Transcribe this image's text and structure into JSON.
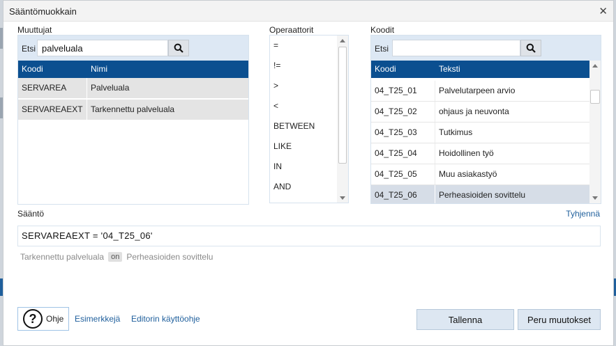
{
  "dialog": {
    "title": "Sääntömuokkain"
  },
  "variables": {
    "label": "Muuttujat",
    "search_label": "Etsi",
    "search_value": "palveluala",
    "columns": [
      "Koodi",
      "Nimi"
    ],
    "rows": [
      {
        "code": "SERVAREA",
        "name": "Palveluala"
      },
      {
        "code": "SERVAREAEXT",
        "name": "Tarkennettu palveluala"
      }
    ]
  },
  "operators": {
    "label": "Operaattorit",
    "items": [
      "=",
      "!=",
      ">",
      "<",
      "BETWEEN",
      "LIKE",
      "IN",
      "AND"
    ]
  },
  "codes": {
    "label": "Koodit",
    "search_label": "Etsi",
    "search_value": "",
    "columns": [
      "Koodi",
      "Teksti"
    ],
    "rows": [
      {
        "code": "04_T25_01",
        "text": "Palvelutarpeen arvio"
      },
      {
        "code": "04_T25_02",
        "text": "ohjaus ja neuvonta"
      },
      {
        "code": "04_T25_03",
        "text": "Tutkimus"
      },
      {
        "code": "04_T25_04",
        "text": "Hoidollinen työ"
      },
      {
        "code": "04_T25_05",
        "text": "Muu asiakastyö"
      },
      {
        "code": "04_T25_06",
        "text": "Perheasioiden sovittelu"
      }
    ],
    "selected_code": "04_T25_06"
  },
  "rule": {
    "label": "Sääntö",
    "clear_label": "Tyhjennä",
    "value": "SERVAREAEXT = '04_T25_06'",
    "preview": {
      "left": "Tarkennettu palveluala",
      "op": "on",
      "right": "Perheasioiden sovittelu"
    }
  },
  "footer": {
    "help_label": "Ohje",
    "examples_link": "Esimerkkejä",
    "guide_link": "Editorin käyttöohje",
    "save_label": "Tallenna",
    "cancel_label": "Peru muutokset"
  },
  "icons": {
    "search": "search-icon",
    "help": "question-circle-icon",
    "close": "close-icon"
  },
  "colors": {
    "table_header": "#0b4f90",
    "panel_header": "#dde8f4",
    "selected_row": "#d6dde7",
    "link": "#1f5f9c"
  }
}
